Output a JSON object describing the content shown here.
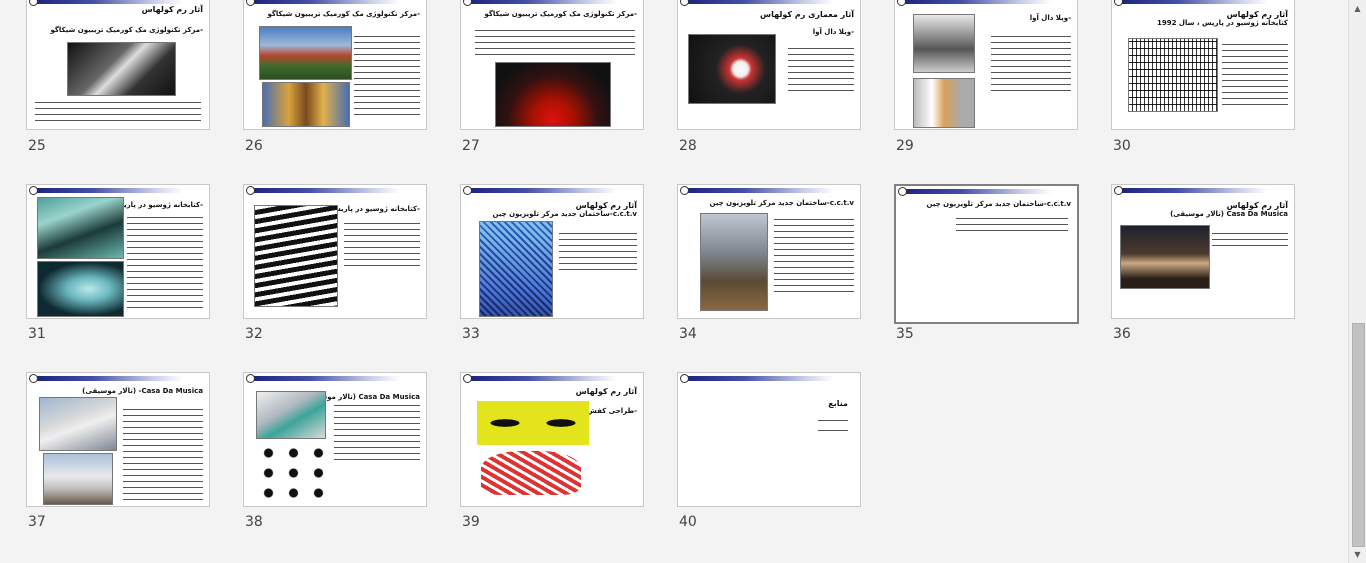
{
  "slides": [
    {
      "num": "25",
      "title": "آثار رم کولهاس",
      "sub": "-مرکز تکنولوژی مک کورمیک تریبیون شیکاگو"
    },
    {
      "num": "26",
      "title": "",
      "sub": "-مرکز تکنولوژی مک کورمیک تریبیون شیکاگو"
    },
    {
      "num": "27",
      "title": "",
      "sub": "-مرکز تکنولوژی مک کورمیک تریبیون شیکاگو"
    },
    {
      "num": "28",
      "title": "آثار معماری رم کولهاس",
      "sub": "-ویلا دال آوا"
    },
    {
      "num": "29",
      "title": "",
      "sub": "-ویلا دال آوا"
    },
    {
      "num": "30",
      "title": "آثار رم کولهاس",
      "sub": "کتابخانه ژوسیو در پاریس ، سال 1992"
    },
    {
      "num": "31",
      "title": "",
      "sub": "-کتابخانه ژوسیو در پاریس"
    },
    {
      "num": "32",
      "title": "",
      "sub": "-کتابخانه ژوسیو در پاریس"
    },
    {
      "num": "33",
      "title": "آثار رم کولهاس",
      "sub": "c.c.t.v-ساختمان جدید مرکز تلویزیون چین"
    },
    {
      "num": "34",
      "title": "",
      "sub": "c.c.t.v-ساختمان جدید مرکز تلویزیون چین"
    },
    {
      "num": "35",
      "title": "",
      "sub": "c.c.t.v-ساختمان جدید مرکز تلویزیون چین"
    },
    {
      "num": "36",
      "title": "آثار رم کولهاس",
      "sub": "Casa Da Musica (تالار موسیقی)"
    },
    {
      "num": "37",
      "title": "",
      "sub": "Casa Da Musica- (تالار موسیقی)"
    },
    {
      "num": "38",
      "title": "",
      "sub": "Casa Da Musica (تالار موسیقی)"
    },
    {
      "num": "39",
      "title": "آثار رم کولهاس",
      "sub": "-طراحی کفش"
    },
    {
      "num": "40",
      "title": "",
      "sub": "منابع"
    }
  ],
  "colors": {
    "background": "#f3f3f3",
    "header_bar": "#1a237e",
    "selected_border": "#808080"
  },
  "scrollbar": {
    "up_icon": "triangle-up",
    "down_icon": "triangle-down"
  }
}
